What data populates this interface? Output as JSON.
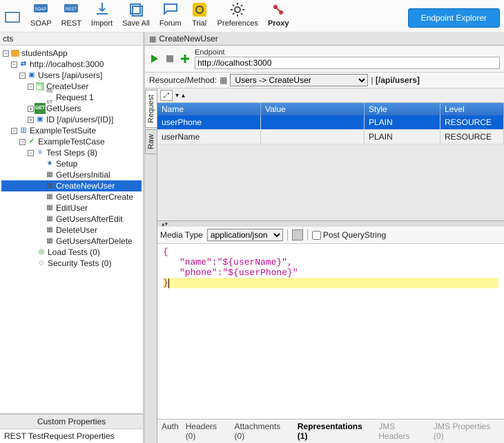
{
  "toolbar": {
    "items": [
      {
        "label": "",
        "icon": "empty-icon"
      },
      {
        "label": "SOAP",
        "icon": "soap-icon"
      },
      {
        "label": "REST",
        "icon": "rest-icon"
      },
      {
        "label": "Import",
        "icon": "import-icon"
      },
      {
        "label": "Save All",
        "icon": "saveall-icon"
      },
      {
        "label": "Forum",
        "icon": "forum-icon"
      },
      {
        "label": "Trial",
        "icon": "trial-icon"
      },
      {
        "label": "Preferences",
        "icon": "preferences-icon"
      },
      {
        "label": "Proxy",
        "icon": "proxy-icon"
      }
    ],
    "endpoint_explorer": "Endpoint Explorer"
  },
  "nav_header": "cts",
  "tree": [
    {
      "d": 0,
      "exp": "-",
      "icon": "folder",
      "text": "studentsApp"
    },
    {
      "d": 1,
      "exp": "-",
      "icon": "swap",
      "text": "http://localhost:3000"
    },
    {
      "d": 2,
      "exp": "-",
      "icon": "users",
      "text": "Users [/api/users]"
    },
    {
      "d": 3,
      "exp": "-",
      "icon": "create",
      "text": "CreateUser"
    },
    {
      "d": 4,
      "exp": "",
      "icon": "rest",
      "text": "Request 1"
    },
    {
      "d": 3,
      "exp": "+",
      "icon": "get",
      "text": "GetUsers"
    },
    {
      "d": 3,
      "exp": "+",
      "icon": "users",
      "text": "ID [/api/users/{ID}]"
    },
    {
      "d": 1,
      "exp": "-",
      "icon": "suite",
      "text": "ExampleTestSuite"
    },
    {
      "d": 2,
      "exp": "-",
      "icon": "check",
      "text": "ExampleTestCase"
    },
    {
      "d": 3,
      "exp": "-",
      "icon": "steps",
      "text": "Test Steps (8)"
    },
    {
      "d": 4,
      "exp": "",
      "icon": "star",
      "text": "Setup"
    },
    {
      "d": 4,
      "exp": "",
      "icon": "grid",
      "text": "GetUsersInitial"
    },
    {
      "d": 4,
      "exp": "",
      "icon": "grid",
      "text": "CreateNewUser",
      "sel": true
    },
    {
      "d": 4,
      "exp": "",
      "icon": "grid",
      "text": "GetUsersAfterCreate"
    },
    {
      "d": 4,
      "exp": "",
      "icon": "grid",
      "text": "EditUser"
    },
    {
      "d": 4,
      "exp": "",
      "icon": "grid",
      "text": "GetUsersAfterEdit"
    },
    {
      "d": 4,
      "exp": "",
      "icon": "grid",
      "text": "DeleteUser"
    },
    {
      "d": 4,
      "exp": "",
      "icon": "grid",
      "text": "GetUsersAfterDelete"
    },
    {
      "d": 3,
      "exp": "",
      "icon": "target",
      "text": "Load Tests (0)"
    },
    {
      "d": 3,
      "exp": "",
      "icon": "security",
      "text": "Security Tests (0)"
    }
  ],
  "left_tabs": {
    "custom": "Custom Properties",
    "rest": "REST TestRequest Properties"
  },
  "editor": {
    "tab_title": "CreateNewUser",
    "endpoint_label": "Endpoint",
    "endpoint_value": "http://localhost:3000",
    "resmeth_label": "Resource/Method:",
    "resmeth_value": "Users -> CreateUser",
    "resmeth_path": "[/api/users]",
    "side_tabs": {
      "request": "Request",
      "raw": "Raw"
    },
    "grid_headers": {
      "name": "Name",
      "value": "Value",
      "style": "Style",
      "level": "Level"
    },
    "grid_rows": [
      {
        "name": "userPhone",
        "value": "",
        "style": "PLAIN",
        "level": "RESOURCE",
        "sel": true
      },
      {
        "name": "userName",
        "value": "",
        "style": "PLAIN",
        "level": "RESOURCE"
      }
    ],
    "media_label": "Media Type",
    "media_value": "application/json",
    "post_qs": "Post QueryString",
    "json_lines": [
      "{",
      "   \"name\":\"${userName}\",",
      "   \"phone\":\"${userPhone}\"",
      "}"
    ],
    "bottom_tabs": [
      {
        "label": "Auth",
        "active": false
      },
      {
        "label": "Headers (0)",
        "active": false
      },
      {
        "label": "Attachments (0)",
        "active": false
      },
      {
        "label": "Representations (1)",
        "active": true
      },
      {
        "label": "JMS Headers",
        "dim": true
      },
      {
        "label": "JMS Properties (0)",
        "dim": true
      }
    ]
  }
}
